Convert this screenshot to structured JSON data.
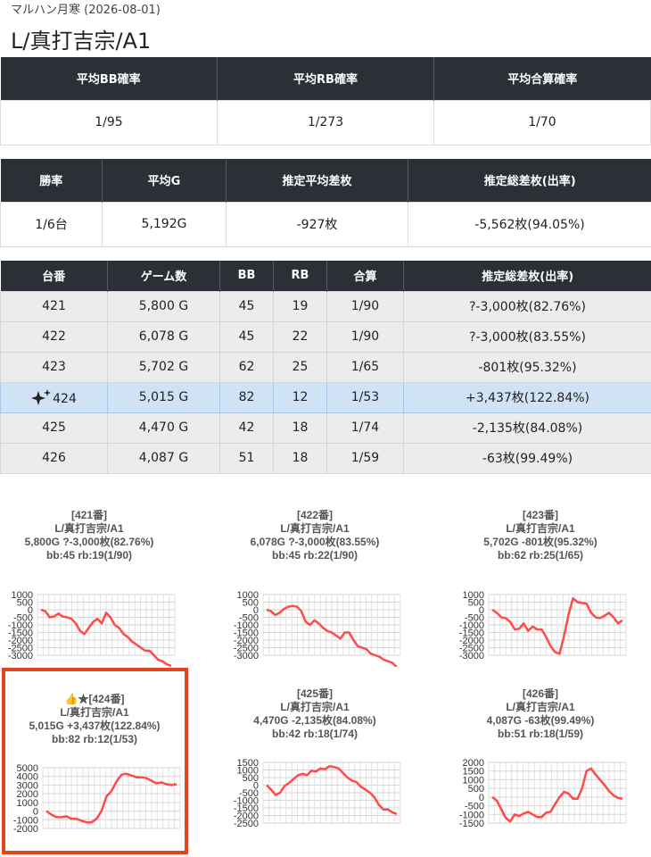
{
  "header": {
    "subtitle": "マルハン月寒 (2026-08-01)",
    "title": "L/真打吉宗/A1"
  },
  "summary1": {
    "headers": [
      "平均BB確率",
      "平均RB確率",
      "平均合算確率"
    ],
    "values": [
      "1/95",
      "1/273",
      "1/70"
    ]
  },
  "summary2": {
    "headers": [
      "勝率",
      "平均G",
      "推定平均差枚",
      "推定総差枚(出率)"
    ],
    "values": [
      "1/6台",
      "5,192G",
      "-927枚",
      "-5,562枚(94.05%)"
    ]
  },
  "machines": {
    "headers": [
      "台番",
      "ゲーム数",
      "BB",
      "RB",
      "合算",
      "推定総差枚(出率)"
    ],
    "rows": [
      {
        "no": "421",
        "games": "5,800 G",
        "bb": "45",
        "rb": "19",
        "total": "1/90",
        "diff": "?-3,000枚(82.76%)",
        "highlight": false
      },
      {
        "no": "422",
        "games": "6,078 G",
        "bb": "45",
        "rb": "22",
        "total": "1/90",
        "diff": "?-3,000枚(83.55%)",
        "highlight": false
      },
      {
        "no": "423",
        "games": "5,702 G",
        "bb": "62",
        "rb": "25",
        "total": "1/65",
        "diff": "-801枚(95.32%)",
        "highlight": false
      },
      {
        "no": "424",
        "games": "5,015 G",
        "bb": "82",
        "rb": "12",
        "total": "1/53",
        "diff": "+3,437枚(122.84%)",
        "highlight": true,
        "icon": "sparkle-icon"
      },
      {
        "no": "425",
        "games": "4,470 G",
        "bb": "42",
        "rb": "18",
        "total": "1/74",
        "diff": "-2,135枚(84.08%)",
        "highlight": false
      },
      {
        "no": "426",
        "games": "4,087 G",
        "bb": "51",
        "rb": "18",
        "total": "1/59",
        "diff": "-63枚(99.49%)",
        "highlight": false
      }
    ]
  },
  "cards": [
    {
      "line1": "[421番]",
      "line2": "L/真打吉宗/A1",
      "line3": "5,800G ?-3,000枚(82.76%)",
      "line4": "bb:45 rb:19(1/90)"
    },
    {
      "line1": "[422番]",
      "line2": "L/真打吉宗/A1",
      "line3": "6,078G ?-3,000枚(83.55%)",
      "line4": "bb:45 rb:22(1/90)"
    },
    {
      "line1": "[423番]",
      "line2": "L/真打吉宗/A1",
      "line3": "5,702G -801枚(95.32%)",
      "line4": "bb:62 rb:25(1/65)"
    },
    {
      "line1": "👍★[424番]",
      "line2": "L/真打吉宗/A1",
      "line3": "5,015G +3,437枚(122.84%)",
      "line4": "bb:82 rb:12(1/53)"
    },
    {
      "line1": "[425番]",
      "line2": "L/真打吉宗/A1",
      "line3": "4,470G -2,135枚(84.08%)",
      "line4": "bb:42 rb:18(1/74)"
    },
    {
      "line1": "[426番]",
      "line2": "L/真打吉宗/A1",
      "line3": "4,087G -63枚(99.49%)",
      "line4": "bb:51 rb:18(1/59)"
    }
  ],
  "chart_data": [
    {
      "type": "line",
      "name": "421",
      "line_color": "#ff4a4a",
      "grid": true,
      "ylim": [
        -3000,
        1000
      ],
      "ticks": [
        "1000",
        "500",
        "0",
        "-500",
        "-1000",
        "-1500",
        "-2000",
        "-2500",
        "-3000"
      ],
      "values": [
        0,
        -100,
        -500,
        -450,
        -250,
        -450,
        -500,
        -600,
        -900,
        -1400,
        -1600,
        -1200,
        -800,
        -600,
        -900,
        -200,
        -500,
        -1000,
        -1200,
        -1600,
        -1800,
        -2100,
        -2300,
        -2500,
        -2700,
        -2700,
        -3000,
        -3300,
        -3400,
        -3600,
        -3700
      ]
    },
    {
      "type": "line",
      "name": "422",
      "line_color": "#ff4a4a",
      "grid": true,
      "ylim": [
        -3000,
        1000
      ],
      "ticks": [
        "1000",
        "500",
        "0",
        "-500",
        "-1000",
        "-1500",
        "-2000",
        "-2500",
        "-3000"
      ],
      "values": [
        0,
        -100,
        -350,
        -200,
        50,
        200,
        250,
        200,
        -100,
        -800,
        -1000,
        -700,
        -900,
        -1200,
        -1400,
        -1500,
        -1700,
        -1900,
        -1500,
        -1500,
        -2000,
        -2400,
        -2500,
        -2600,
        -2900,
        -3000,
        -3100,
        -3300,
        -3400,
        -3500,
        -3800
      ]
    },
    {
      "type": "line",
      "name": "423",
      "line_color": "#ff4a4a",
      "grid": true,
      "ylim": [
        -3000,
        1000
      ],
      "ticks": [
        "1000",
        "500",
        "0",
        "-500",
        "-1000",
        "-1500",
        "-2000",
        "-2500",
        "-3000"
      ],
      "values": [
        0,
        -200,
        -500,
        -550,
        -800,
        -1300,
        -1250,
        -900,
        -1400,
        -1100,
        -1300,
        -1300,
        -1800,
        -2400,
        -2800,
        -2900,
        -1700,
        -300,
        750,
        500,
        450,
        400,
        -200,
        -500,
        -550,
        -400,
        -200,
        -500,
        -900,
        -700
      ]
    },
    {
      "type": "line",
      "name": "424",
      "line_color": "#ff4a4a",
      "grid": true,
      "ylim": [
        -2000,
        5000
      ],
      "ticks": [
        "5000",
        "4000",
        "3000",
        "2000",
        "1000",
        "0",
        "-1000",
        "-2000"
      ],
      "values": [
        0,
        -400,
        -700,
        -700,
        -600,
        -900,
        -900,
        -1100,
        -1300,
        -1300,
        -900,
        0,
        1700,
        2300,
        3400,
        4200,
        4300,
        4100,
        3900,
        3900,
        3800,
        3500,
        3200,
        3300,
        3100,
        3000,
        3100
      ]
    },
    {
      "type": "line",
      "name": "425",
      "line_color": "#ff4a4a",
      "grid": true,
      "ylim": [
        -2500,
        1500
      ],
      "ticks": [
        "1500",
        "1000",
        "500",
        "0",
        "-500",
        "-1000",
        "-1500",
        "-2000",
        "-2500"
      ],
      "values": [
        0,
        -300,
        -650,
        -500,
        -50,
        150,
        400,
        650,
        750,
        650,
        950,
        900,
        1100,
        1050,
        1250,
        1200,
        1100,
        800,
        500,
        300,
        200,
        -100,
        -300,
        -500,
        -800,
        -1300,
        -1600,
        -1600,
        -1800,
        -1900
      ]
    },
    {
      "type": "line",
      "name": "426",
      "line_color": "#ff4a4a",
      "grid": true,
      "ylim": [
        -1500,
        2000
      ],
      "ticks": [
        "2000",
        "1500",
        "1000",
        "500",
        "0",
        "-500",
        "-1000",
        "-1500"
      ],
      "values": [
        0,
        -200,
        -700,
        -1200,
        -1400,
        -1000,
        -1100,
        -950,
        -850,
        -1000,
        -1150,
        -1150,
        -900,
        -850,
        -400,
        0,
        300,
        200,
        -100,
        -100,
        500,
        1500,
        1650,
        1300,
        1000,
        700,
        350,
        100,
        -50,
        -100
      ]
    }
  ]
}
